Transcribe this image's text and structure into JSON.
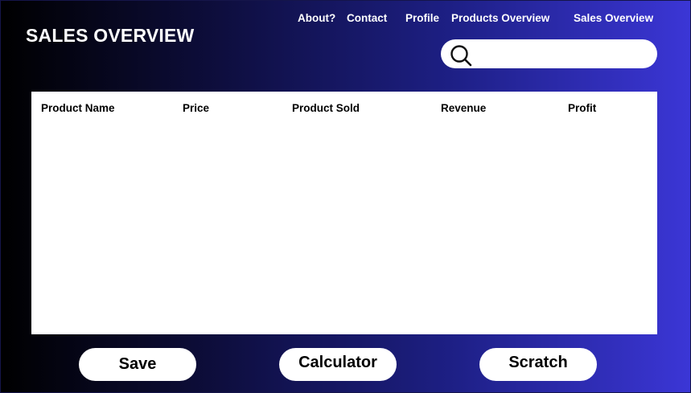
{
  "header": {
    "title": "SALES OVERVIEW"
  },
  "nav": {
    "items": [
      {
        "label": "About?"
      },
      {
        "label": "Contact"
      },
      {
        "label": "Profile"
      },
      {
        "label": "Products Overview"
      },
      {
        "label": "Sales Overview"
      }
    ]
  },
  "search": {
    "icon": "search-icon",
    "value": "",
    "placeholder": ""
  },
  "table": {
    "columns": [
      "Product Name",
      "Price",
      "Product Sold",
      "Revenue",
      "Profit"
    ],
    "rows": []
  },
  "actions": {
    "save_label": "Save",
    "calculator_label": "Calculator",
    "scratch_label": "Scratch"
  },
  "colors": {
    "background_start": "#000000",
    "background_end": "#3b36d6",
    "panel": "#ffffff",
    "text_light": "#ffffff",
    "text_dark": "#000000"
  }
}
